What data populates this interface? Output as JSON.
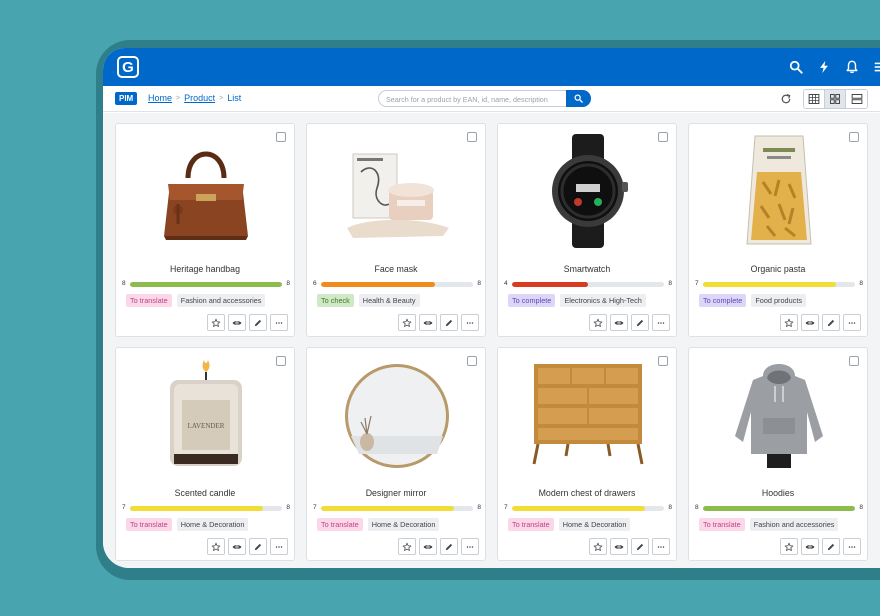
{
  "app": {
    "logo_letter": "G",
    "brand_color": "#0068c9"
  },
  "topbar": {
    "icons": [
      "search-icon",
      "lightning-icon",
      "bell-icon",
      "menu-icon"
    ]
  },
  "subbar": {
    "badge": "PIM",
    "breadcrumb": [
      {
        "label": "Home",
        "link": true
      },
      {
        "label": "Product",
        "link": true
      },
      {
        "label": "List",
        "link": false
      }
    ],
    "breadcrumb_sep": ">",
    "search_placeholder": "Search for a product by EAN, id, name, description",
    "view_modes": [
      "table-view",
      "grid-view",
      "list-view"
    ],
    "active_view": "grid-view"
  },
  "status_styles": {
    "To translate": {
      "bg": "#fbd7ea",
      "fg": "#c0437f"
    },
    "To check": {
      "bg": "#cfe8c6",
      "fg": "#3e7a2e"
    },
    "To complete": {
      "bg": "#ddd6f7",
      "fg": "#5d48b8"
    }
  },
  "products": [
    {
      "name": "Heritage handbag",
      "score": 8,
      "max": 8,
      "bar_color": "#8dbb4c",
      "status": "To translate",
      "category": "Fashion and accessories",
      "image": "handbag"
    },
    {
      "name": "Face mask",
      "score": 6,
      "max": 8,
      "bar_color": "#f28b1e",
      "status": "To check",
      "category": "Health & Beauty",
      "image": "facemask"
    },
    {
      "name": "Smartwatch",
      "score": 4,
      "max": 8,
      "bar_color": "#d83b1f",
      "status": "To complete",
      "category": "Electronics & High-Tech",
      "image": "watch"
    },
    {
      "name": "Organic pasta",
      "score": 7,
      "max": 8,
      "bar_color": "#f2dd34",
      "status": "To complete",
      "category": "Food products",
      "image": "pasta"
    },
    {
      "name": "Scented candle",
      "score": 7,
      "max": 8,
      "bar_color": "#f2dd34",
      "status": "To translate",
      "category": "Home & Decoration",
      "image": "candle",
      "image_text": "LAVENDER"
    },
    {
      "name": "Designer mirror",
      "score": 7,
      "max": 8,
      "bar_color": "#f2dd34",
      "status": "To translate",
      "category": "Home & Decoration",
      "image": "mirror"
    },
    {
      "name": "Modern chest of drawers",
      "score": 7,
      "max": 8,
      "bar_color": "#f2dd34",
      "status": "To translate",
      "category": "Home & Decoration",
      "image": "drawers"
    },
    {
      "name": "Hoodies",
      "score": 8,
      "max": 8,
      "bar_color": "#8dbb4c",
      "status": "To translate",
      "category": "Fashion and accessories",
      "image": "hoodie"
    }
  ],
  "card_actions": [
    "star-icon",
    "eye-icon",
    "pencil-icon",
    "more-icon"
  ]
}
